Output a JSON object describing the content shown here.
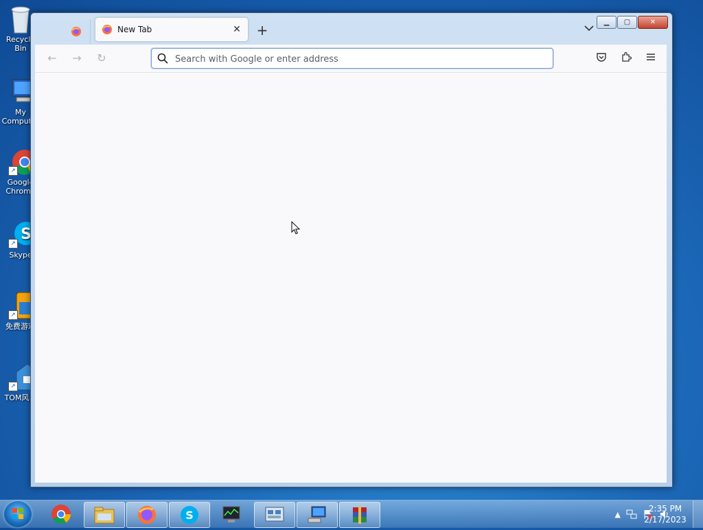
{
  "desktop": {
    "icons": [
      {
        "label": "Recycle Bin"
      },
      {
        "label": "My Computer"
      },
      {
        "label": "Google Chrome"
      },
      {
        "label": "Skype"
      },
      {
        "label": "免费游戏"
      },
      {
        "label": "TOM风…"
      }
    ]
  },
  "browser": {
    "tab_title": "New Tab",
    "url_placeholder": "Search with Google or enter address",
    "url_value": ""
  },
  "taskbar": {
    "apps": [
      "chrome-icon",
      "file-explorer-icon",
      "firefox-icon",
      "skype-icon",
      "task-manager-icon",
      "control-panel-icon",
      "network-computer-icon",
      "winrar-icon"
    ],
    "clock_time": "2:35 PM",
    "clock_date": "2/17/2023"
  },
  "colors": {
    "desktop_bg": "#1c68b8",
    "content_bg": "#f9f9fb",
    "close_button": "#c4452f"
  }
}
